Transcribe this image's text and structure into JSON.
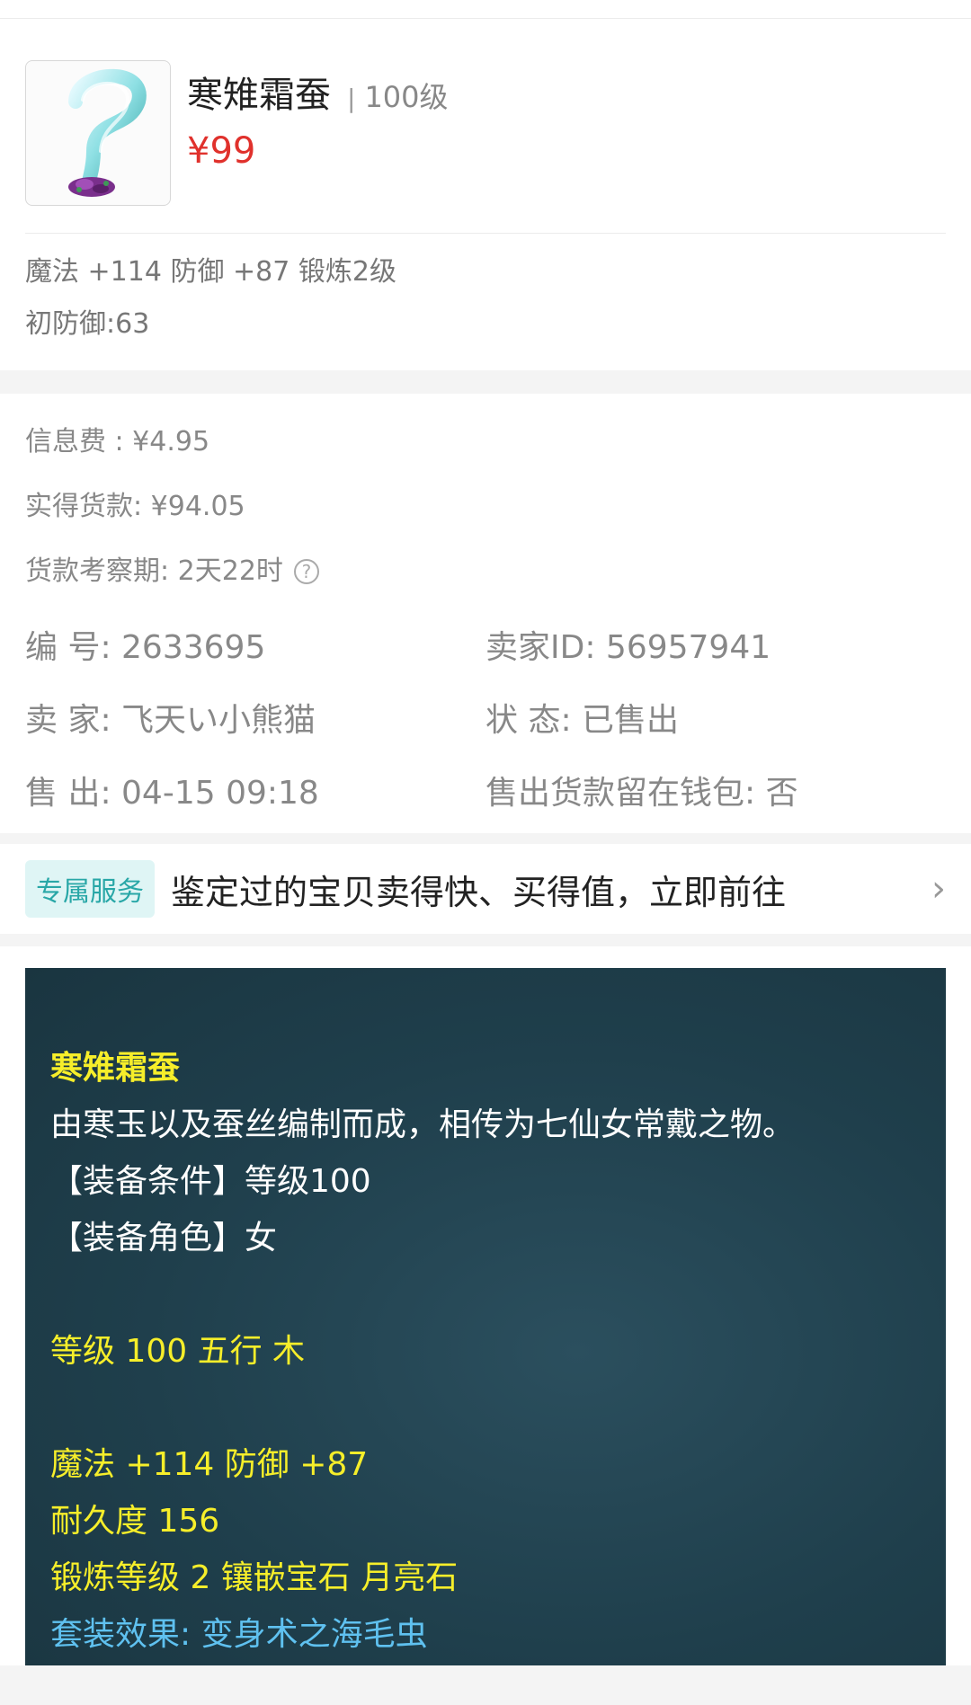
{
  "item": {
    "title": "寒雉霜蚕",
    "level": "100级",
    "price": "¥99",
    "attr_line1": "魔法 +114 防御 +87 锻炼2级",
    "attr_line2": "初防御:63"
  },
  "fees": {
    "info_fee": "信息费 : ¥4.95",
    "actual_payment": "实得货款: ¥94.05",
    "review_period": "货款考察期: 2天22时",
    "help_icon": "?"
  },
  "details": {
    "serial": "编  号: 2633695",
    "seller_id": "卖家ID: 56957941",
    "seller": "卖  家: 飞天い小熊猫",
    "status": "状  态: 已售出",
    "sold_time": "售  出: 04-15 09:18",
    "keep_in_wallet": "售出货款留在钱包: 否"
  },
  "service": {
    "badge": "专属服务",
    "text": "鉴定过的宝贝卖得快、买得值，立即前往",
    "chevron": "›"
  },
  "description": {
    "title": "寒雉霜蚕",
    "line1": "由寒玉以及蚕丝编制而成，相传为七仙女常戴之物。",
    "line2": "【装备条件】等级100",
    "line3": "【装备角色】女",
    "line4": "等级 100 五行 木",
    "line5": "魔法 +114 防御 +87",
    "line6": "耐久度 156",
    "line7": "锻炼等级 2 镶嵌宝石 月亮石",
    "line8": "套装效果: 变身术之海毛虫"
  },
  "colors": {
    "price": "#e0312c",
    "desc_bg": "#1f3f4c",
    "desc_yellow": "#f6ee2a",
    "desc_blue": "#5fc1f0",
    "badge_bg": "#dff5f5",
    "badge_text": "#28a7a7"
  },
  "icons": {
    "item_image": "jade-silk-ribbon-icon",
    "help": "question-circle-icon",
    "chevron": "chevron-right-icon"
  }
}
